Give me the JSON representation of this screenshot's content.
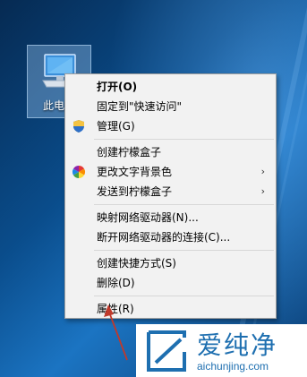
{
  "desktop": {
    "icon": {
      "label": "此电脑",
      "icon": "computer-icon"
    }
  },
  "context_menu": {
    "groups": [
      [
        {
          "label": "打开(O)",
          "bold": true
        },
        {
          "label": "固定到\"快速访问\""
        },
        {
          "label": "管理(G)",
          "icon": "shield-icon"
        }
      ],
      [
        {
          "label": "创建柠檬盒子"
        },
        {
          "label": "更改文字背景色",
          "icon": "color-wheel-icon",
          "submenu": true
        },
        {
          "label": "发送到柠檬盒子",
          "submenu": true
        }
      ],
      [
        {
          "label": "映射网络驱动器(N)..."
        },
        {
          "label": "断开网络驱动器的连接(C)..."
        }
      ],
      [
        {
          "label": "创建快捷方式(S)"
        },
        {
          "label": "删除(D)"
        }
      ],
      [
        {
          "label": "属性(R)"
        }
      ]
    ],
    "submenu_arrow": "›"
  },
  "watermark": {
    "title": "爱纯净",
    "url": "aichunjing.com"
  },
  "colors": {
    "menu_background": "#f2f2f2",
    "annotation_arrow": "#c0392b",
    "watermark_blue": "#1e6fb0"
  }
}
